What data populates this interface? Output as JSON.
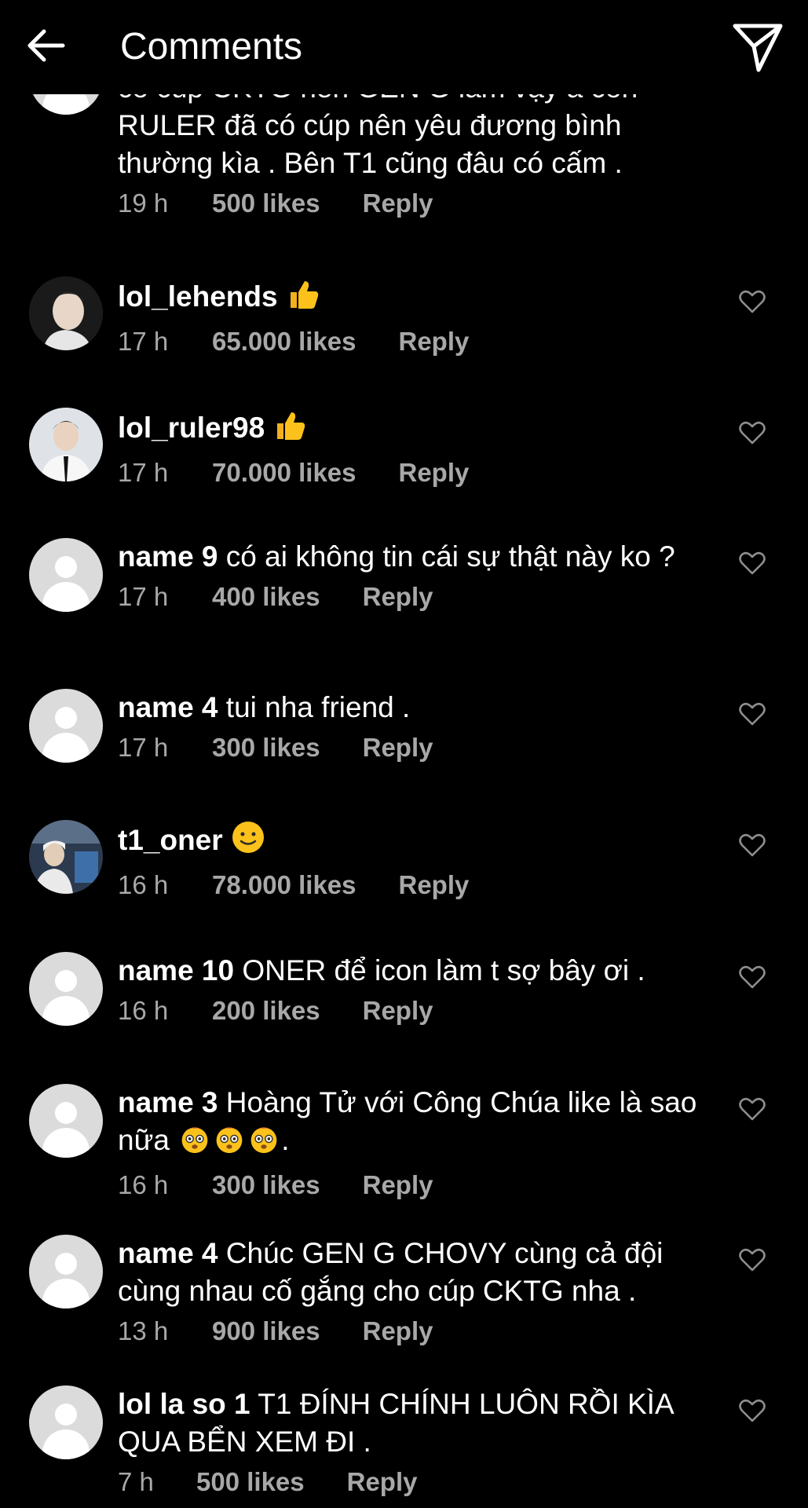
{
  "header": {
    "title": "Comments"
  },
  "comments": [
    {
      "text_lines": [
        "có cúp CKTG nên GEN G làm vậy à còn",
        "RULER đã có cúp nên yêu đương bình",
        "thường kìa . Bên T1 cũng đâu có cấm ."
      ],
      "time": "19 h",
      "likes": "500 likes",
      "reply": "Reply"
    },
    {
      "username": "lol_lehends",
      "text": "",
      "emoji": "thumbs-up",
      "time": "17 h",
      "likes": "65.000 likes",
      "reply": "Reply"
    },
    {
      "username": "lol_ruler98",
      "text": "",
      "emoji": "thumbs-up",
      "time": "17 h",
      "likes": "70.000 likes",
      "reply": "Reply"
    },
    {
      "username": "name 9",
      "text": "có ai không tin cái sự thật này ko ?",
      "time": "17 h",
      "likes": "400 likes",
      "reply": "Reply"
    },
    {
      "username": "name 4",
      "text": "tui nha friend .",
      "time": "17 h",
      "likes": "300 likes",
      "reply": "Reply"
    },
    {
      "username": "t1_oner",
      "text": "",
      "emoji": "slight-smile",
      "time": "16 h",
      "likes": "78.000 likes",
      "reply": "Reply"
    },
    {
      "username": "name 10",
      "text": "ONER để icon làm t sợ bây ơi .",
      "time": "16 h",
      "likes": "200 likes",
      "reply": "Reply"
    },
    {
      "username": "name 3",
      "text": "Hoàng Tử với Công Chúa like là sao nữa",
      "text_after": ".",
      "emoji": "flushed-x3",
      "time": "16 h",
      "likes": "300 likes",
      "reply": "Reply"
    },
    {
      "username": "name 4",
      "text": "Chúc GEN G CHOVY cùng cả đội cùng nhau cố gắng cho cúp CKTG nha .",
      "time": "13 h",
      "likes": "900 likes",
      "reply": "Reply"
    },
    {
      "username": "lol la so 1",
      "text": "T1 ĐÍNH CHÍNH LUÔN RỒI KÌA QUA BỂN XEM ĐI .",
      "time": "7 h",
      "likes": "500 likes",
      "reply": "Reply"
    }
  ],
  "icons": {
    "back": "arrow-left-icon",
    "send": "paper-plane-icon",
    "like": "heart-outline-icon"
  },
  "colors": {
    "background": "#000000",
    "text": "#ffffff",
    "meta": "#a8a8a8",
    "avatar_default": "#dbdbdb"
  }
}
